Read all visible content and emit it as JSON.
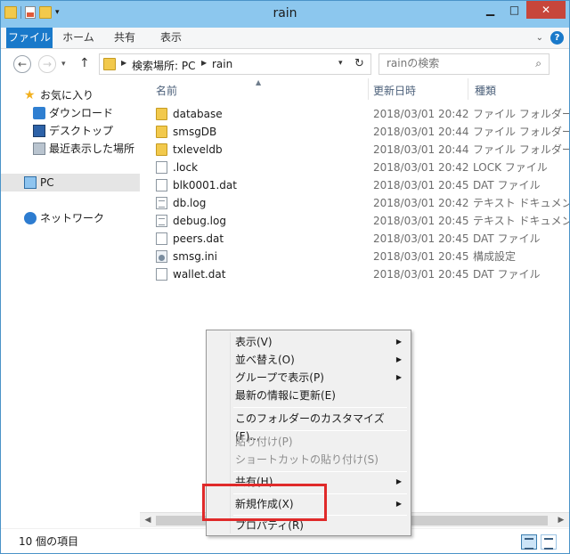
{
  "window": {
    "title": "rain"
  },
  "ribbon": {
    "tabs": [
      "ファイル",
      "ホーム",
      "共有",
      "表示"
    ]
  },
  "address": {
    "crumbs": [
      "検索場所: PC",
      "rain"
    ]
  },
  "search": {
    "placeholder": "rainの検索"
  },
  "nav": {
    "favorites": "お気に入り",
    "items": [
      "ダウンロード",
      "デスクトップ",
      "最近表示した場所"
    ],
    "pc": "PC",
    "network": "ネットワーク"
  },
  "columns": {
    "name": "名前",
    "date": "更新日時",
    "type": "種類"
  },
  "files": [
    {
      "icon": "folder-icon",
      "name": "database",
      "date": "2018/03/01 20:42",
      "type": "ファイル フォルダー"
    },
    {
      "icon": "folder-icon",
      "name": "smsgDB",
      "date": "2018/03/01 20:44",
      "type": "ファイル フォルダー"
    },
    {
      "icon": "folder-icon",
      "name": "txleveldb",
      "date": "2018/03/01 20:44",
      "type": "ファイル フォルダー"
    },
    {
      "icon": "file-icon",
      "name": ".lock",
      "date": "2018/03/01 20:42",
      "type": "LOCK ファイル"
    },
    {
      "icon": "file-icon",
      "name": "blk0001.dat",
      "date": "2018/03/01 20:45",
      "type": "DAT ファイル"
    },
    {
      "icon": "text-file-icon",
      "name": "db.log",
      "date": "2018/03/01 20:42",
      "type": "テキスト ドキュメント"
    },
    {
      "icon": "text-file-icon",
      "name": "debug.log",
      "date": "2018/03/01 20:45",
      "type": "テキスト ドキュメント"
    },
    {
      "icon": "file-icon",
      "name": "peers.dat",
      "date": "2018/03/01 20:45",
      "type": "DAT ファイル"
    },
    {
      "icon": "settings-file-icon",
      "name": "smsg.ini",
      "date": "2018/03/01 20:45",
      "type": "構成設定"
    },
    {
      "icon": "file-icon",
      "name": "wallet.dat",
      "date": "2018/03/01 20:45",
      "type": "DAT ファイル"
    }
  ],
  "status": {
    "count": "10 個の項目"
  },
  "context_menu": {
    "items": [
      {
        "label": "表示(V)",
        "submenu": true,
        "enabled": true
      },
      {
        "label": "並べ替え(O)",
        "submenu": true,
        "enabled": true
      },
      {
        "label": "グループで表示(P)",
        "submenu": true,
        "enabled": true
      },
      {
        "label": "最新の情報に更新(E)",
        "submenu": false,
        "enabled": true
      },
      {
        "label": "このフォルダーのカスタマイズ(F)...",
        "submenu": false,
        "enabled": true
      },
      {
        "label": "貼り付け(P)",
        "submenu": false,
        "enabled": false
      },
      {
        "label": "ショートカットの貼り付け(S)",
        "submenu": false,
        "enabled": false
      },
      {
        "label": "共有(H)",
        "submenu": true,
        "enabled": true
      },
      {
        "label": "新規作成(X)",
        "submenu": true,
        "enabled": true
      },
      {
        "label": "プロパティ(R)",
        "submenu": false,
        "enabled": true
      }
    ]
  },
  "colors": {
    "accent": "#1979ca",
    "highlight_box": "#e02a2a",
    "frame": "#6fb7e8"
  }
}
